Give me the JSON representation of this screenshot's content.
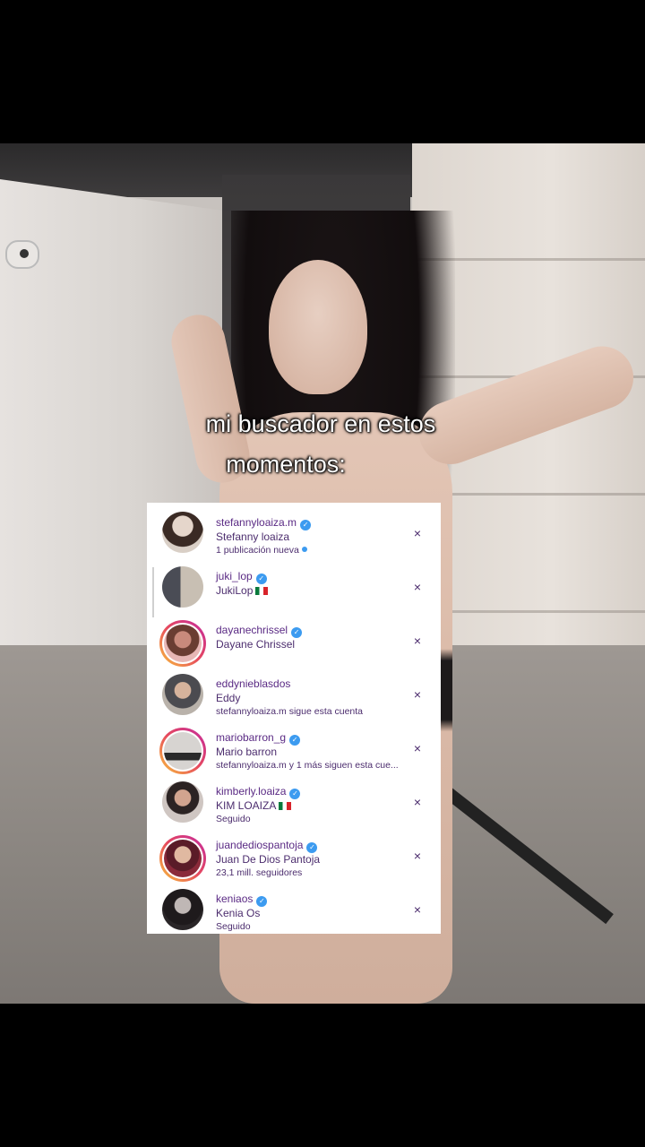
{
  "caption": {
    "line1": "mi buscador en estos",
    "line2": "momentos:"
  },
  "search_results": [
    {
      "username": "stefannyloaiza.m",
      "verified": true,
      "full_name": "Stefanny loaiza",
      "subtitle": "1 publicación nueva",
      "new_indicator": true,
      "story_ring": false,
      "avatar_colors": [
        "#d9cfc6",
        "#3a2a24"
      ]
    },
    {
      "username": "juki_lop",
      "verified": true,
      "full_name": "JukiLop",
      "flag": "mexico",
      "subtitle": "",
      "story_ring": false,
      "avatar_colors": [
        "#5b5d66",
        "#c8bfb3"
      ]
    },
    {
      "username": "dayanechrissel",
      "verified": true,
      "full_name": "Dayane Chrissel",
      "subtitle": "",
      "story_ring": true,
      "avatar_colors": [
        "#e7b7b5",
        "#6a3d32"
      ]
    },
    {
      "username": "eddynieblasdos",
      "verified": false,
      "full_name": "Eddy",
      "subtitle": "stefannyloaiza.m sigue esta cuenta",
      "story_ring": false,
      "avatar_colors": [
        "#b9b2aa",
        "#4b4b50"
      ]
    },
    {
      "username": "mariobarron_g",
      "verified": true,
      "full_name": "Mario barron",
      "subtitle": "stefannyloaiza.m y 1 más siguen esta cue...",
      "story_ring": true,
      "avatar_colors": [
        "#d7d4d1",
        "#2a2a2a"
      ]
    },
    {
      "username": "kimberly.loaiza",
      "verified": true,
      "full_name": "KIM LOAIZA",
      "flag": "mexico",
      "subtitle": "Seguido",
      "story_ring": false,
      "avatar_colors": [
        "#cfc6c2",
        "#2c2323"
      ]
    },
    {
      "username": "juandediospantoja",
      "verified": true,
      "full_name": "Juan De Dios Pantoja",
      "subtitle": "23,1 mill. seguidores",
      "story_ring": true,
      "avatar_colors": [
        "#8b2a3a",
        "#e0b9a1"
      ]
    },
    {
      "username": "keniaos",
      "verified": true,
      "full_name": "Kenia Os",
      "subtitle": "Seguido",
      "story_ring": false,
      "avatar_colors": [
        "#2a2628",
        "#bfb7b5"
      ]
    }
  ],
  "icons": {
    "verified": "check-badge",
    "remove": "×"
  },
  "colors": {
    "username": "#5a2a84",
    "verified_badge": "#3c9bf0",
    "panel_bg": "#ffffff"
  }
}
